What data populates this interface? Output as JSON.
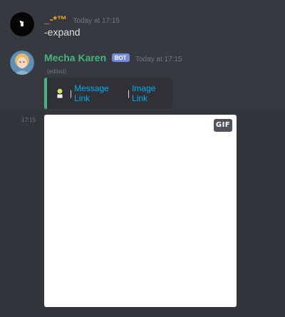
{
  "messages": [
    {
      "author": "_-*™",
      "author_color": "#faa61a",
      "timestamp": "Today at 17:15",
      "content": "-expand"
    },
    {
      "author": "Mecha Karen",
      "author_color": "#43b581",
      "bot_badge": "BOT",
      "timestamp": "Today at 17:15",
      "edited": "(edited)",
      "embed": {
        "border_color": "#43b581",
        "separator": "|",
        "link1": "Message Link",
        "link2": "Image Link"
      },
      "attachment": {
        "side_timestamp": "17:15",
        "badge": "GIF"
      }
    }
  ],
  "colors": {
    "background": "#36393f",
    "embed_bg": "#2f3136",
    "link": "#00b0f4",
    "bot_badge": "#7289da"
  }
}
